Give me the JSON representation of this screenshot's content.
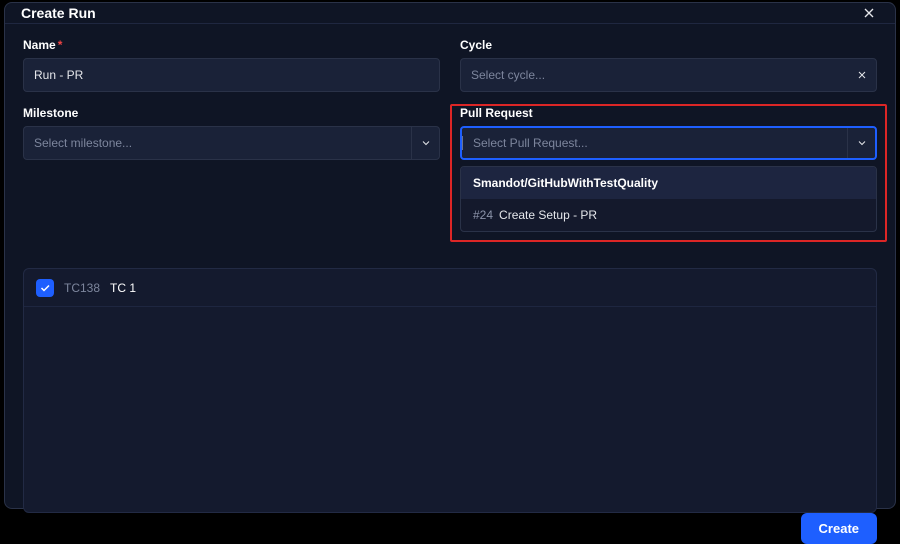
{
  "header": {
    "title": "Create Run"
  },
  "fields": {
    "name": {
      "label": "Name",
      "required": "*",
      "value": "Run - PR"
    },
    "cycle": {
      "label": "Cycle",
      "placeholder": "Select cycle..."
    },
    "milestone": {
      "label": "Milestone",
      "placeholder": "Select milestone..."
    },
    "pull_request": {
      "label": "Pull Request",
      "placeholder": "Select Pull Request..."
    }
  },
  "pr_dropdown": {
    "group": "Smandot/GitHubWithTestQuality",
    "items": [
      {
        "num": "#24",
        "label": "Create Setup - PR"
      }
    ]
  },
  "test_cases": [
    {
      "id": "TC138",
      "name": "TC 1",
      "checked": true
    }
  ],
  "footer": {
    "create": "Create"
  }
}
